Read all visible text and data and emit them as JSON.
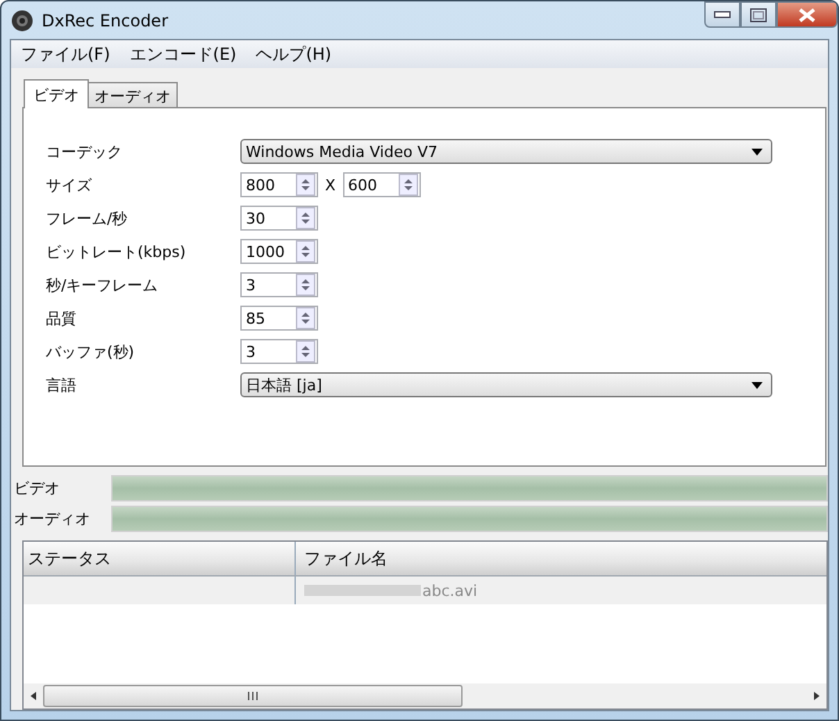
{
  "window": {
    "title": "DxRec Encoder"
  },
  "menu": [
    "ファイル(F)",
    "エンコード(E)",
    "ヘルプ(H)"
  ],
  "tabs": [
    {
      "label": "ビデオ",
      "selected": true
    },
    {
      "label": "オーディオ",
      "selected": false
    }
  ],
  "settings": [
    {
      "kind": "combo",
      "label": "コーデック",
      "value": "Windows Media Video V7"
    },
    {
      "kind": "size",
      "label": "サイズ",
      "value": "800",
      "separator": "X",
      "value2": "600"
    },
    {
      "kind": "spin",
      "label": "フレーム/秒",
      "value": "30"
    },
    {
      "kind": "spin",
      "label": "ビットレート(kbps)",
      "value": "1000"
    },
    {
      "kind": "spin",
      "label": "秒/キーフレーム",
      "value": "3"
    },
    {
      "kind": "spin",
      "label": "品質",
      "value": "85"
    },
    {
      "kind": "spin",
      "label": "バッファ(秒)",
      "value": "3"
    },
    {
      "kind": "combo",
      "label": "言語",
      "value": "日本語 [ja]"
    }
  ],
  "progress": [
    {
      "label": "ビデオ",
      "level": 1
    },
    {
      "label": "オーディオ",
      "level": 1
    }
  ],
  "table": {
    "columns": [
      "ステータス",
      "ファイル名"
    ],
    "rows": [
      [
        "",
        "abc.avi"
      ]
    ]
  }
}
